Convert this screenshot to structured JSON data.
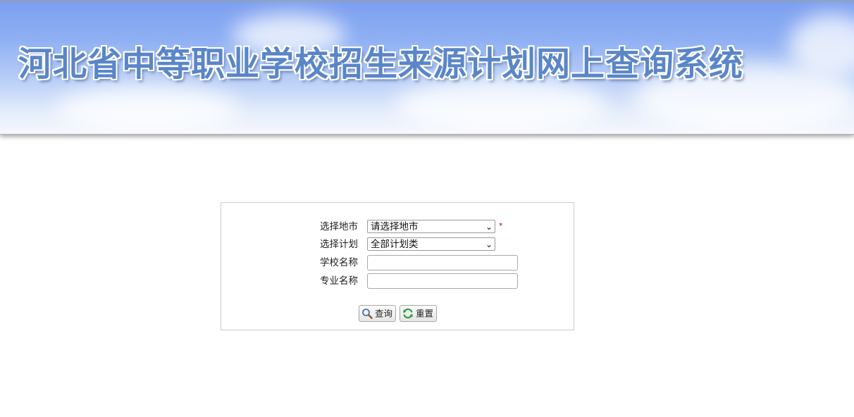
{
  "header": {
    "title": "河北省中等职业学校招生来源计划网上查询系统"
  },
  "form": {
    "city": {
      "label": "选择地市",
      "value": "请选择地市",
      "required_mark": "*"
    },
    "plan": {
      "label": "选择计划",
      "value": "全部计划类"
    },
    "school": {
      "label": "学校名称",
      "value": ""
    },
    "major": {
      "label": "专业名称",
      "value": ""
    },
    "buttons": {
      "search_label": "查询",
      "reset_label": "重置"
    }
  },
  "icons": {
    "search": "magnifier-icon",
    "reset": "refresh-icon",
    "dropdown": "chevron-down-icon"
  },
  "colors": {
    "banner_top": "#7c9ef0",
    "title_text": "#5a86c8",
    "required": "#cc0000",
    "panel_border": "#cccccc"
  }
}
